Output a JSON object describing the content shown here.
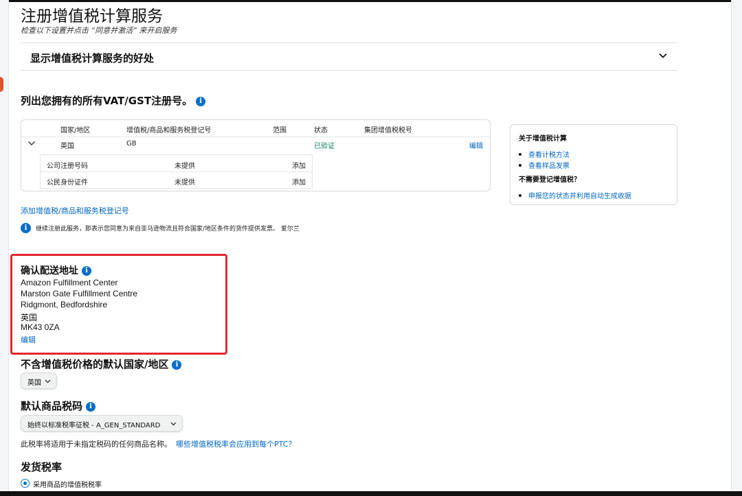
{
  "header": {
    "title": "注册增值税计算服务",
    "subtitle": "检查以下设置并点击 “同意并激活” 来开启服务"
  },
  "benefits": {
    "label": "显示增值税计算服务的好处"
  },
  "registrations": {
    "heading": "列出您拥有的所有VAT/GST注册号。",
    "columns": [
      "国家/地区",
      "增值税/商品和服务税登记号",
      "范围",
      "状态",
      "集团增值税税号"
    ],
    "row": {
      "country": "英国",
      "number": "GB",
      "scope": "",
      "status": "已验证",
      "group_number": "",
      "edit": "编辑"
    },
    "sub_rows": [
      {
        "label": "公司注册号码",
        "value": "未提供",
        "action": "添加"
      },
      {
        "label": "公民身份证件",
        "value": "未提供",
        "action": "添加"
      }
    ],
    "add_link": "添加增值税/商品和服务税登记号",
    "notice": "继续注册此服务，即表示您同意为来自亚马逊物流且符合国家/地区条件的货件提供发票。 爱尔兰"
  },
  "sidebar": {
    "title": "关于增值税计算",
    "links": [
      "查看计税方法",
      "查看样品发票"
    ],
    "subtitle": "不需要登记增值税？",
    "sublink": "申报您的状态并利用自动生成收据"
  },
  "shipping_address": {
    "heading": "确认配送地址",
    "lines": [
      "Amazon Fulfillment Center",
      "Marston Gate Fulfillment Centre",
      "Ridgmont, Bedfordshire",
      "英国",
      "MK43 0ZA"
    ],
    "edit": "编辑"
  },
  "default_country": {
    "heading": "不含增值税价格的默认国家/地区",
    "selected": "英国"
  },
  "default_tax_code": {
    "heading": "默认商品税码",
    "selected": "始终以标准税率征税 - A_GEN_STANDARD",
    "note": "此税率将适用于未指定税码的任何商品名称。",
    "note_link": "哪些增值税税率会应用到每个PTC？"
  },
  "shipping_rate": {
    "heading": "发货税率",
    "option": "采用商品的增值税税率"
  },
  "icons": [
    "chevron-down-icon",
    "info-icon",
    "radio-selected-icon"
  ],
  "colors": {
    "link": "#0066c0",
    "verified": "#067d62",
    "info": "#0a6ec6",
    "highlight": "#e3262f"
  }
}
